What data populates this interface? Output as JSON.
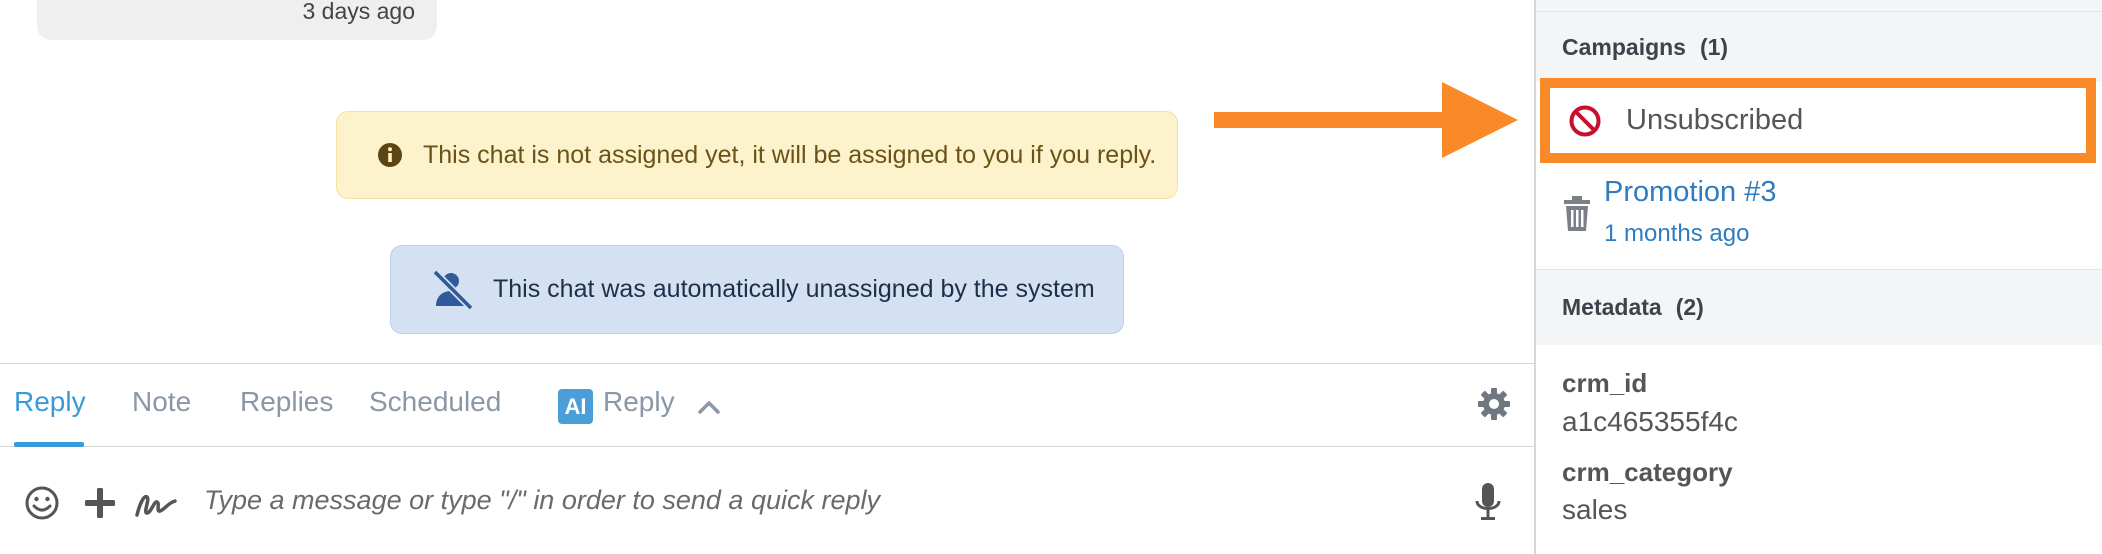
{
  "chat": {
    "last_message_time": "3 days ago",
    "warning_notice": "This chat is not assigned yet, it will be assigned to you if you reply.",
    "info_notice": "This chat was automatically unassigned by the system"
  },
  "tabs": [
    {
      "label": "Reply",
      "active": true
    },
    {
      "label": "Note",
      "active": false
    },
    {
      "label": "Replies",
      "active": false
    },
    {
      "label": "Scheduled",
      "active": false
    }
  ],
  "ai_tab": {
    "badge": "AI",
    "label": "Reply"
  },
  "composer": {
    "placeholder": "Type a message or type \"/\" in order to send a quick reply"
  },
  "sidebar": {
    "campaigns": {
      "title": "Campaigns",
      "count": "(1)",
      "status": "Unsubscribed",
      "items": [
        {
          "name": "Promotion #3",
          "time": "1 months ago"
        }
      ]
    },
    "metadata": {
      "title": "Metadata",
      "count": "(2)",
      "fields": [
        {
          "key": "crm_id",
          "value": "a1c465355f4c"
        },
        {
          "key": "crm_category",
          "value": "sales"
        }
      ]
    }
  },
  "colors": {
    "accent": "#3a9ad9",
    "highlight": "#fa8a28",
    "warning_bg": "#fcf2cc",
    "info_bg": "#d3e1f2",
    "link": "#2f7cc1",
    "unsubscribe_red": "#c8102e"
  },
  "icons": [
    "info-icon",
    "unassigned-user-icon",
    "chevron-up-icon",
    "gear-icon",
    "emoji-icon",
    "plus-icon",
    "signature-icon",
    "microphone-icon",
    "unsubscribe-icon",
    "trash-icon"
  ]
}
